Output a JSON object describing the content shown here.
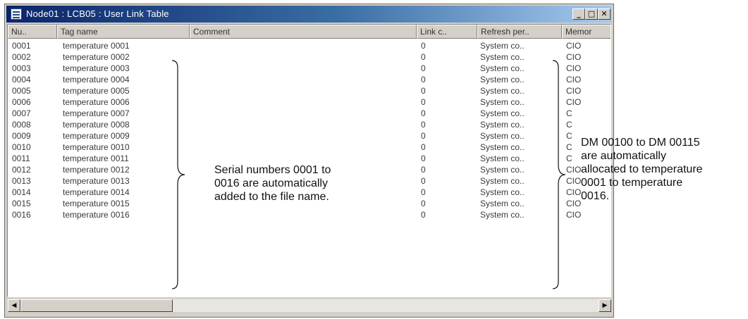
{
  "window": {
    "title": "Node01 : LCB05 : User Link Table",
    "buttons": {
      "minimize": "_",
      "maximize": "□",
      "close": "✕"
    }
  },
  "columns": [
    "Nu..",
    "Tag name",
    "Comment",
    "Link c..",
    "Refresh per..",
    "Memor"
  ],
  "rows": [
    {
      "num": "0001",
      "tag": "temperature 0001",
      "link": "0",
      "refresh": "System co..",
      "mem": "CIO"
    },
    {
      "num": "0002",
      "tag": "temperature 0002",
      "link": "0",
      "refresh": "System co..",
      "mem": "CIO"
    },
    {
      "num": "0003",
      "tag": "temperature 0003",
      "link": "0",
      "refresh": "System co..",
      "mem": "CIO"
    },
    {
      "num": "0004",
      "tag": "temperature 0004",
      "link": "0",
      "refresh": "System co..",
      "mem": "CIO"
    },
    {
      "num": "0005",
      "tag": "temperature 0005",
      "link": "0",
      "refresh": "System co..",
      "mem": "CIO"
    },
    {
      "num": "0006",
      "tag": "temperature 0006",
      "link": "0",
      "refresh": "System co..",
      "mem": "CIO"
    },
    {
      "num": "0007",
      "tag": "temperature 0007",
      "link": "0",
      "refresh": "System co..",
      "mem": "C"
    },
    {
      "num": "0008",
      "tag": "temperature 0008",
      "link": "0",
      "refresh": "System co..",
      "mem": "C"
    },
    {
      "num": "0009",
      "tag": "temperature 0009",
      "link": "0",
      "refresh": "System co..",
      "mem": "C"
    },
    {
      "num": "0010",
      "tag": "temperature 0010",
      "link": "0",
      "refresh": "System co..",
      "mem": "C"
    },
    {
      "num": "0011",
      "tag": "temperature 0011",
      "link": "0",
      "refresh": "System co..",
      "mem": "C"
    },
    {
      "num": "0012",
      "tag": "temperature 0012",
      "link": "0",
      "refresh": "System co..",
      "mem": "CIO"
    },
    {
      "num": "0013",
      "tag": "temperature 0013",
      "link": "0",
      "refresh": "System co..",
      "mem": "CIO"
    },
    {
      "num": "0014",
      "tag": "temperature 0014",
      "link": "0",
      "refresh": "System co..",
      "mem": "CIO"
    },
    {
      "num": "0015",
      "tag": "temperature 0015",
      "link": "0",
      "refresh": "System co..",
      "mem": "CIO"
    },
    {
      "num": "0016",
      "tag": "temperature 0016",
      "link": "0",
      "refresh": "System co..",
      "mem": "CIO"
    }
  ],
  "annotations": {
    "serial": [
      "Serial numbers 0001 to",
      "0016 are automatically",
      "added to the file name."
    ],
    "dm": [
      "DM 00100 to DM 00115",
      "are automatically",
      "allocated to temperature",
      "0001 to temperature",
      "0016."
    ]
  },
  "scrollbar": {
    "left_arrow": "◀",
    "right_arrow": "▶"
  }
}
